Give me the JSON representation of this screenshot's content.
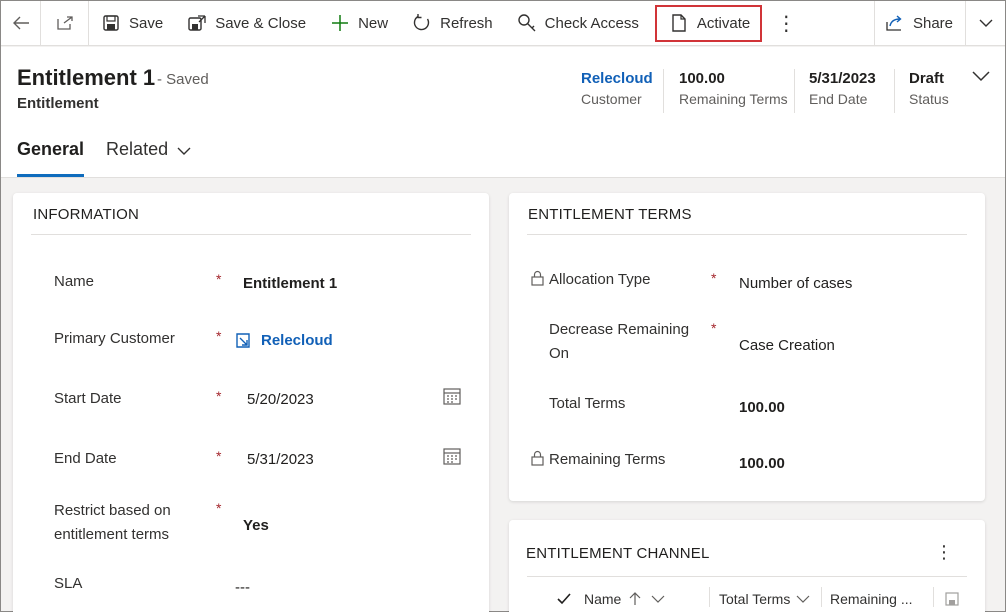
{
  "toolbar": {
    "save": "Save",
    "save_close": "Save & Close",
    "new": "New",
    "refresh": "Refresh",
    "check_access": "Check Access",
    "activate": "Activate",
    "share": "Share"
  },
  "record": {
    "title": "Entitlement 1",
    "saved_status": "- Saved",
    "entity": "Entitlement",
    "header_fields": [
      {
        "value": "Relecloud",
        "label": "Customer"
      },
      {
        "value": "100.00",
        "label": "Remaining Terms"
      },
      {
        "value": "5/31/2023",
        "label": "End Date"
      },
      {
        "value": "Draft",
        "label": "Status"
      }
    ]
  },
  "tabs": [
    {
      "label": "General",
      "active": true
    },
    {
      "label": "Related",
      "active": false
    }
  ],
  "information": {
    "title": "INFORMATION",
    "fields": {
      "name": {
        "label": "Name",
        "value": "Entitlement 1"
      },
      "customer": {
        "label": "Primary Customer",
        "value": "Relecloud"
      },
      "start_date": {
        "label": "Start Date",
        "value": "5/20/2023"
      },
      "end_date": {
        "label": "End Date",
        "value": "5/31/2023"
      },
      "restrict": {
        "label_line1": "Restrict based on",
        "label_line2": "entitlement terms",
        "value": "Yes"
      },
      "sla": {
        "label": "SLA",
        "value": "---"
      }
    },
    "required_mark": "*"
  },
  "terms": {
    "title": "ENTITLEMENT TERMS",
    "fields": {
      "allocation_type": {
        "label": "Allocation Type",
        "value": "Number of cases"
      },
      "decrease_on": {
        "label_line1": "Decrease Remaining",
        "label_line2": "On",
        "value": "Case Creation"
      },
      "total_terms": {
        "label": "Total Terms",
        "value": "100.00"
      },
      "remaining_terms": {
        "label": "Remaining Terms",
        "value": "100.00"
      }
    }
  },
  "channel": {
    "title": "ENTITLEMENT CHANNEL",
    "columns": [
      "Name",
      "Total Terms",
      "Remaining ..."
    ]
  },
  "colors": {
    "accent": "#0f6cbd",
    "link": "#1160b7",
    "required": "#a4262c",
    "highlight_border": "#d13438"
  }
}
